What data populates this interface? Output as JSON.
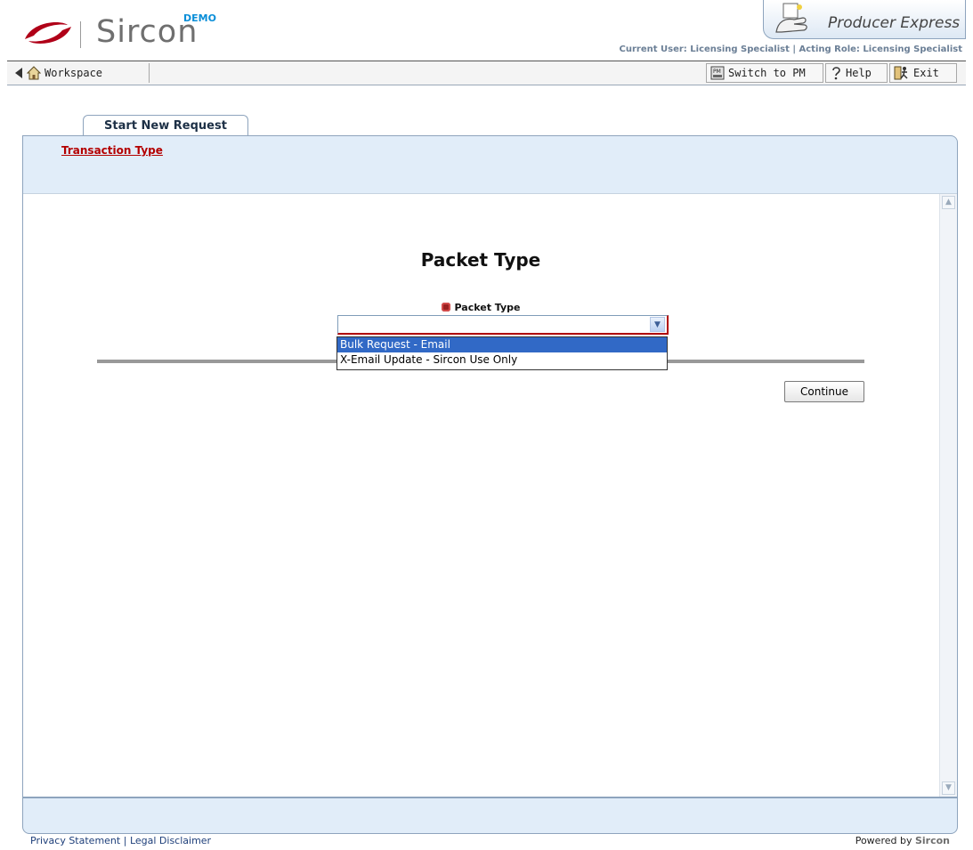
{
  "brand": {
    "name": "Sircon",
    "badge": "DEMO",
    "product": "Producer Express",
    "brand_red": "#b00018"
  },
  "user_bar": {
    "text": "Current User: Licensing Specialist | Acting Role: Licensing Specialist"
  },
  "toolbar": {
    "workspace_label": "Workspace",
    "switch_label": "Switch to PM",
    "help_label": "Help",
    "exit_label": "Exit"
  },
  "tabs": {
    "active_label": "Start New Request"
  },
  "breadcrumb": {
    "transaction_type": "Transaction Type"
  },
  "form": {
    "title": "Packet Type",
    "field_label": "Packet Type",
    "selected_value": "",
    "options": [
      "Bulk Request - Email",
      "X-Email Update - Sircon Use Only"
    ],
    "highlighted_option": "Bulk Request - Email",
    "continue_label": "Continue"
  },
  "footer": {
    "privacy": "Privacy Statement",
    "separator": "|",
    "legal": "Legal Disclaimer",
    "powered_prefix": "Powered by",
    "powered_brand": "Sircon"
  }
}
